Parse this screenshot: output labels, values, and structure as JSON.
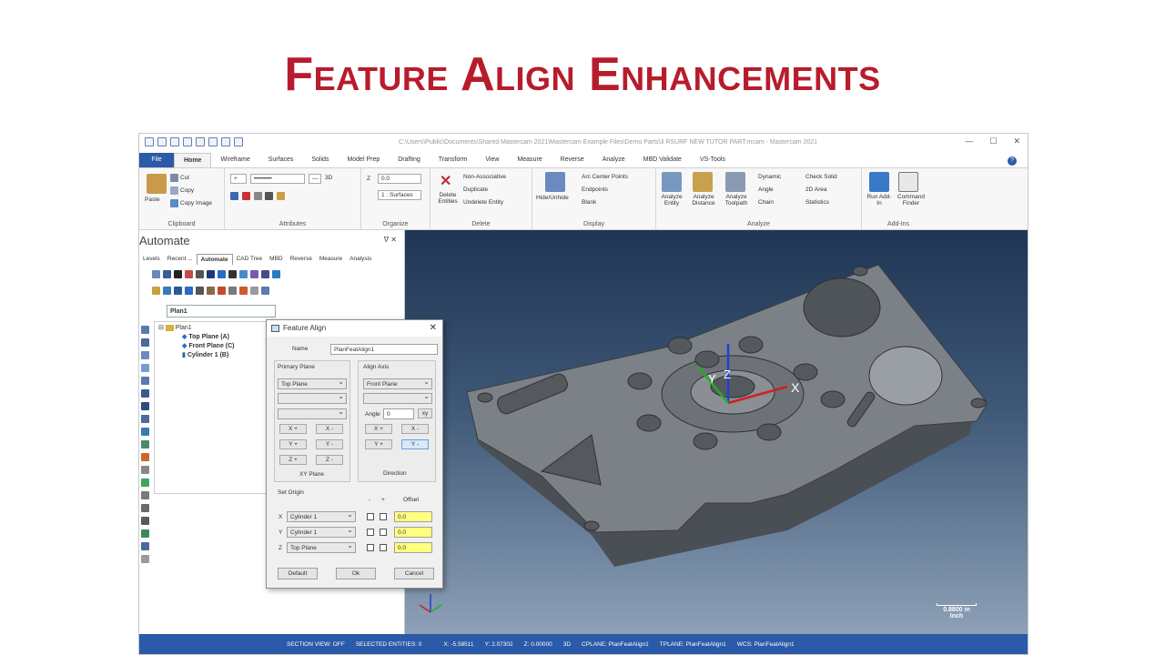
{
  "slide": {
    "title": "Feature Align Enhancements"
  },
  "window": {
    "path": "C:\\Users\\Public\\Documents\\Shared Mastercam 2021\\Mastercam Example Files\\Demo Parts\\3 RSURF NEW TUTOR PART.mcam - Mastercam 2021",
    "min": "—",
    "max": "☐",
    "close": "✕"
  },
  "ribbon_tabs": [
    "File",
    "Home",
    "Wireframe",
    "Surfaces",
    "Solids",
    "Model Prep",
    "Drafting",
    "Transform",
    "View",
    "Measure",
    "Reverse",
    "Analyze",
    "MBD Validate",
    "VS-Tools"
  ],
  "help": "?",
  "clipboard": {
    "paste": "Paste",
    "cut": "Cut",
    "copy": "Copy",
    "copy_image": "Copy Image",
    "label": "Clipboard"
  },
  "attributes": {
    "value_3d": "3D",
    "label": "Attributes"
  },
  "organize": {
    "z": "Z",
    "z_val": "0.0",
    "level": "1 : Surfaces",
    "label": "Organize"
  },
  "delete": {
    "delete_entities": "Delete Entities",
    "non_assoc": "Non-Associative",
    "duplicate": "Duplicate",
    "undelete": "Undelete Entity",
    "label": "Delete"
  },
  "display": {
    "hide": "Hide/Unhide",
    "arc_center": "Arc Center Points",
    "endpoints": "Endpoints",
    "blank": "Blank",
    "label": "Display"
  },
  "analyze": {
    "analyze_entity": "Analyze Entity",
    "analyze_distance": "Analyze Distance",
    "analyze_toolpath": "Analyze Toolpath",
    "dynamic": "Dynamic",
    "angle": "Angle",
    "chain": "Chain",
    "check_solid": "Check Solid",
    "area_2d": "2D Area",
    "statistics": "Statistics",
    "label": "Analyze"
  },
  "addins": {
    "run": "Run Add-In",
    "command_finder": "Command Finder",
    "label": "Add-Ins"
  },
  "left_panel": {
    "title": "Automate",
    "pin": "ᐁ  ✕",
    "tabs": [
      "Levels",
      "Recent ...",
      "Automate",
      "CAD Tree",
      "MBD",
      "Reverse",
      "Measure",
      "Analysis"
    ],
    "plane": "Plan1",
    "tree": {
      "root": "Plan1",
      "items": [
        "Top Plane (A)",
        "Front Plane (C)",
        "Cylinder 1 (B)"
      ]
    }
  },
  "dialog": {
    "title": "Feature Align",
    "name_label": "Name",
    "name_value": "PlanFeatAlign1",
    "primary_plane": "Primary Plane",
    "primary_sel": "Top Plane",
    "align_axis": "Align Axis",
    "align_sel": "Front Plane",
    "angle_label": "Angle",
    "angle_value": "0",
    "xy_btn": "xy",
    "buttons_primary": [
      "X +",
      "X -",
      "Y +",
      "Y -",
      "Z +",
      "Z -"
    ],
    "xy_plane": "XY Plane",
    "buttons_align": [
      "X +",
      "X -",
      "Y +",
      "Y -"
    ],
    "direction": "Direction",
    "set_origin": "Set Origin",
    "minus": "-",
    "plus": "+",
    "offset": "Offset",
    "origin_rows": [
      {
        "axis": "X",
        "sel": "Cylinder 1",
        "val": "0.0"
      },
      {
        "axis": "Y",
        "sel": "Cylinder 1",
        "val": "0.0"
      },
      {
        "axis": "Z",
        "sel": "Top Plane",
        "val": "0.0"
      }
    ],
    "default_btn": "Default",
    "ok_btn": "Ok",
    "cancel_btn": "Cancel"
  },
  "viewport": {
    "scale": "0.8800 in",
    "scale_unit": "Inch",
    "axis": {
      "x": "X",
      "y": "Y",
      "z": "Z"
    }
  },
  "status": {
    "section_view": "SECTION VIEW: OFF",
    "selected": "SELECTED ENTITIES: 0",
    "x": "X:   -5.58511",
    "y": "Y:   2.07302",
    "z": "Z:   0.00000",
    "mode": "3D",
    "cplane": "CPLANE: PlanFeatAlign1",
    "tplane": "TPLANE: PlanFeatAlign1",
    "wcs": "WCS: PlanFeatAlign1"
  },
  "colors": {
    "title_red": "#b81c2c",
    "file_blue": "#2a5aa8"
  }
}
